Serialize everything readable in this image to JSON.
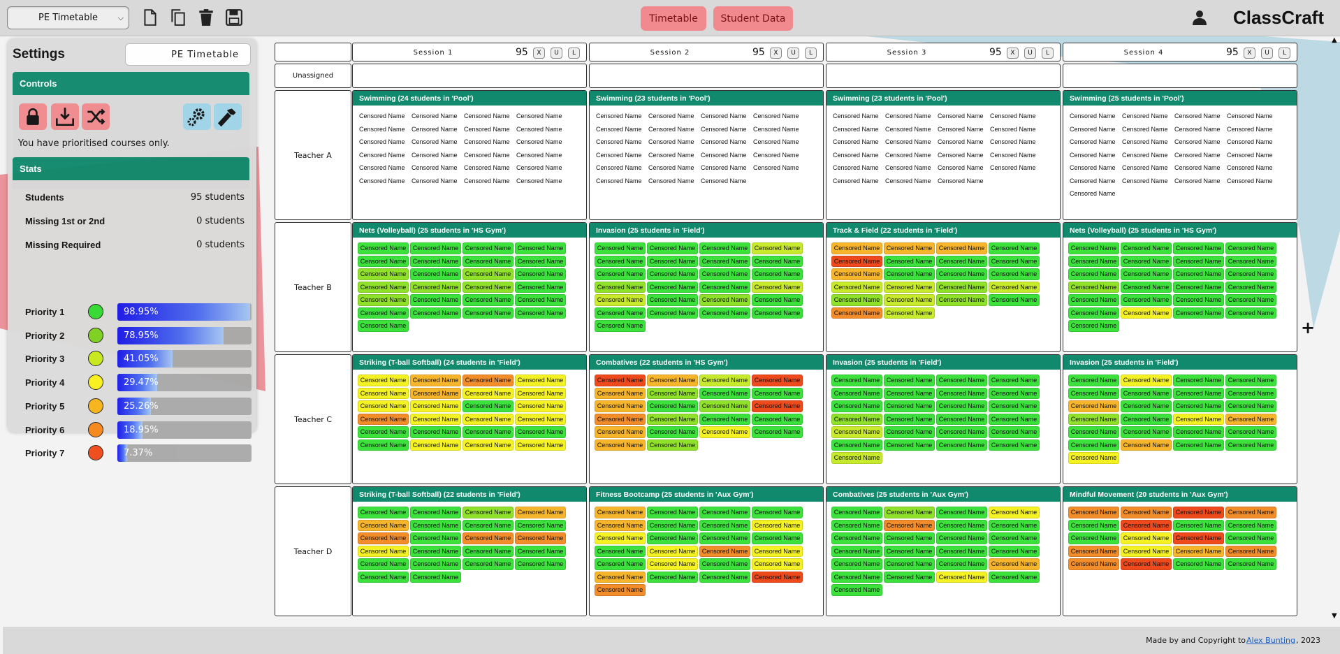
{
  "topbar": {
    "timetable_select": "PE Timetable",
    "icons": [
      "new-file-icon",
      "copy-icon",
      "trash-icon",
      "save-icon"
    ],
    "nav": [
      "Timetable",
      "Student Data"
    ],
    "brand": "ClassCraft"
  },
  "settings": {
    "title": "Settings",
    "timetable_name": "PE Timetable",
    "controls_header": "Controls",
    "controls": [
      {
        "icon": "lock-icon",
        "color": "#f08a8e"
      },
      {
        "icon": "import-icon",
        "color": "#f08a8e"
      },
      {
        "icon": "shuffle-icon",
        "color": "#f08a8e"
      },
      {
        "icon": "gears-icon",
        "color": "#9ed3e6"
      },
      {
        "icon": "hammer-icon",
        "color": "#9ed3e6"
      }
    ],
    "message": "You have prioritised courses only.",
    "stats_header": "Stats",
    "stats": [
      {
        "label": "Students",
        "value": "95 students"
      },
      {
        "label": "Missing 1st or 2nd",
        "value": "0 students"
      },
      {
        "label": "Missing Required",
        "value": "0 students"
      }
    ],
    "priorities": [
      {
        "label": "Priority 1",
        "color": "#33dd33",
        "pct_text": "98.95%",
        "pct": 98.95
      },
      {
        "label": "Priority 2",
        "color": "#7ed321",
        "pct_text": "78.95%",
        "pct": 78.95
      },
      {
        "label": "Priority 3",
        "color": "#c9e81a",
        "pct_text": "41.05%",
        "pct": 41.05
      },
      {
        "label": "Priority 4",
        "color": "#f9f01b",
        "pct_text": "29.47%",
        "pct": 29.47
      },
      {
        "label": "Priority 5",
        "color": "#f8b31a",
        "pct_text": "25.26%",
        "pct": 25.26
      },
      {
        "label": "Priority 6",
        "color": "#f7861a",
        "pct_text": "18.95%",
        "pct": 18.95
      },
      {
        "label": "Priority 7",
        "color": "#f04a1a",
        "pct_text": "7.37%",
        "pct": 7.37
      }
    ]
  },
  "sessions": [
    {
      "name": "Session 1",
      "count": "95",
      "buttons": [
        "X",
        "U",
        "L"
      ]
    },
    {
      "name": "Session 2",
      "count": "95",
      "buttons": [
        "X",
        "U",
        "L"
      ]
    },
    {
      "name": "Session 3",
      "count": "95",
      "buttons": [
        "X",
        "U",
        "L"
      ]
    },
    {
      "name": "Session 4",
      "count": "95",
      "buttons": [
        "X",
        "U",
        "L"
      ]
    }
  ],
  "unassigned_label": "Unassigned",
  "teachers": [
    "Teacher A",
    "Teacher B",
    "Teacher C",
    "Teacher D"
  ],
  "priority_colors": {
    "0": "#ffffff",
    "1": "#3ce13c",
    "2": "#8fe12a",
    "3": "#c8ea2c",
    "4": "#f5f224",
    "5": "#f7b52c",
    "6": "#f38d2a",
    "7": "#ee4a1c"
  },
  "student_name": "Censored Name",
  "classes": [
    [
      {
        "title": "Swimming (24 students in 'Pool')",
        "students": [
          0,
          0,
          0,
          0,
          0,
          0,
          0,
          0,
          0,
          0,
          0,
          0,
          0,
          0,
          0,
          0,
          0,
          0,
          0,
          0,
          0,
          0,
          0,
          0
        ]
      },
      {
        "title": "Swimming (23 students in 'Pool')",
        "students": [
          0,
          0,
          0,
          0,
          0,
          0,
          0,
          0,
          0,
          0,
          0,
          0,
          0,
          0,
          0,
          0,
          0,
          0,
          0,
          0,
          0,
          0,
          0
        ]
      },
      {
        "title": "Swimming (23 students in 'Pool')",
        "students": [
          0,
          0,
          0,
          0,
          0,
          0,
          0,
          0,
          0,
          0,
          0,
          0,
          0,
          0,
          0,
          0,
          0,
          0,
          0,
          0,
          0,
          0,
          0
        ]
      },
      {
        "title": "Swimming (25 students in 'Pool')",
        "students": [
          0,
          0,
          0,
          0,
          0,
          0,
          0,
          0,
          0,
          0,
          0,
          0,
          0,
          0,
          0,
          0,
          0,
          0,
          0,
          0,
          0,
          0,
          0,
          0,
          0
        ]
      }
    ],
    [
      {
        "title": "Nets (Volleyball) (25 students in 'HS Gym')",
        "students": [
          1,
          1,
          1,
          1,
          1,
          1,
          1,
          1,
          2,
          1,
          2,
          1,
          2,
          2,
          2,
          1,
          2,
          1,
          1,
          1,
          1,
          1,
          1,
          1,
          1
        ]
      },
      {
        "title": "Invasion (25 students in 'Field')",
        "students": [
          1,
          1,
          1,
          3,
          1,
          1,
          1,
          1,
          1,
          1,
          1,
          1,
          2,
          1,
          1,
          3,
          3,
          1,
          2,
          1,
          1,
          1,
          1,
          1,
          1
        ]
      },
      {
        "title": "Track & Field (22 students in 'Field')",
        "students": [
          5,
          5,
          5,
          1,
          7,
          1,
          1,
          1,
          5,
          1,
          1,
          1,
          3,
          3,
          2,
          3,
          2,
          3,
          2,
          1,
          6,
          3
        ]
      },
      {
        "title": "Nets (Volleyball) (25 students in 'HS Gym')",
        "students": [
          1,
          1,
          1,
          1,
          1,
          1,
          1,
          1,
          1,
          1,
          1,
          1,
          2,
          1,
          1,
          1,
          1,
          1,
          1,
          1,
          1,
          4,
          1,
          1,
          1
        ]
      }
    ],
    [
      {
        "title": "Striking (T-ball Softball) (24 students in 'Field')",
        "students": [
          4,
          5,
          6,
          4,
          4,
          5,
          4,
          4,
          4,
          4,
          1,
          4,
          6,
          4,
          4,
          4,
          1,
          1,
          1,
          1,
          1,
          4,
          4,
          4
        ]
      },
      {
        "title": "Combatives (22 students in 'HS Gym')",
        "students": [
          7,
          5,
          3,
          7,
          5,
          2,
          1,
          1,
          5,
          1,
          2,
          7,
          6,
          2,
          1,
          1,
          5,
          1,
          4,
          1,
          5,
          2
        ]
      },
      {
        "title": "Invasion (25 students in 'Field')",
        "students": [
          1,
          1,
          1,
          1,
          1,
          1,
          1,
          1,
          1,
          1,
          1,
          1,
          2,
          1,
          1,
          1,
          3,
          1,
          1,
          1,
          1,
          1,
          1,
          1,
          3
        ]
      },
      {
        "title": "Invasion (25 students in 'Field')",
        "students": [
          1,
          4,
          1,
          1,
          1,
          1,
          1,
          1,
          5,
          1,
          1,
          1,
          2,
          1,
          4,
          5,
          1,
          1,
          1,
          1,
          1,
          5,
          1,
          1,
          4
        ]
      }
    ],
    [
      {
        "title": "Striking (T-ball Softball) (22 students in 'Field')",
        "students": [
          1,
          1,
          2,
          5,
          5,
          1,
          1,
          1,
          6,
          1,
          6,
          6,
          4,
          1,
          1,
          1,
          1,
          1,
          1,
          1,
          1,
          1
        ]
      },
      {
        "title": "Fitness Bootcamp (25 students in 'Aux Gym')",
        "students": [
          5,
          1,
          1,
          1,
          5,
          1,
          1,
          4,
          4,
          1,
          1,
          1,
          1,
          4,
          6,
          4,
          1,
          4,
          1,
          4,
          5,
          1,
          1,
          7,
          6
        ]
      },
      {
        "title": "Combatives (25 students in 'Aux Gym')",
        "students": [
          1,
          2,
          1,
          4,
          1,
          6,
          1,
          1,
          1,
          1,
          1,
          1,
          1,
          1,
          1,
          1,
          1,
          1,
          1,
          5,
          1,
          1,
          4,
          1,
          1
        ]
      },
      {
        "title": "Mindful Movement (20 students in 'Aux Gym')",
        "students": [
          6,
          6,
          7,
          6,
          1,
          7,
          1,
          1,
          1,
          4,
          7,
          1,
          6,
          4,
          5,
          6,
          6,
          7,
          1,
          1
        ]
      }
    ]
  ],
  "footer": {
    "prefix": "Made by and Copyright to ",
    "author": "Alex Bunting",
    "suffix": ", 2023"
  }
}
